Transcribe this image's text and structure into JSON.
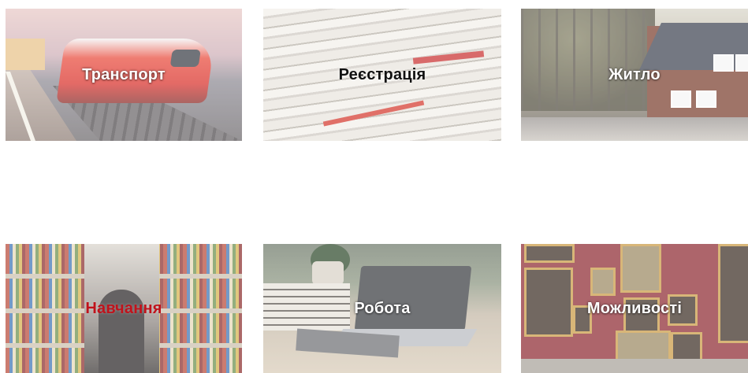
{
  "tiles": [
    {
      "label": "Транспорт"
    },
    {
      "label": "Реєстрація"
    },
    {
      "label": "Житло"
    },
    {
      "label": "Навчання"
    },
    {
      "label": "Робота"
    },
    {
      "label": "Можливості"
    }
  ],
  "colors": {
    "label_light": "#ffffff",
    "label_dark": "#111111",
    "label_accent": "#c0121b"
  }
}
